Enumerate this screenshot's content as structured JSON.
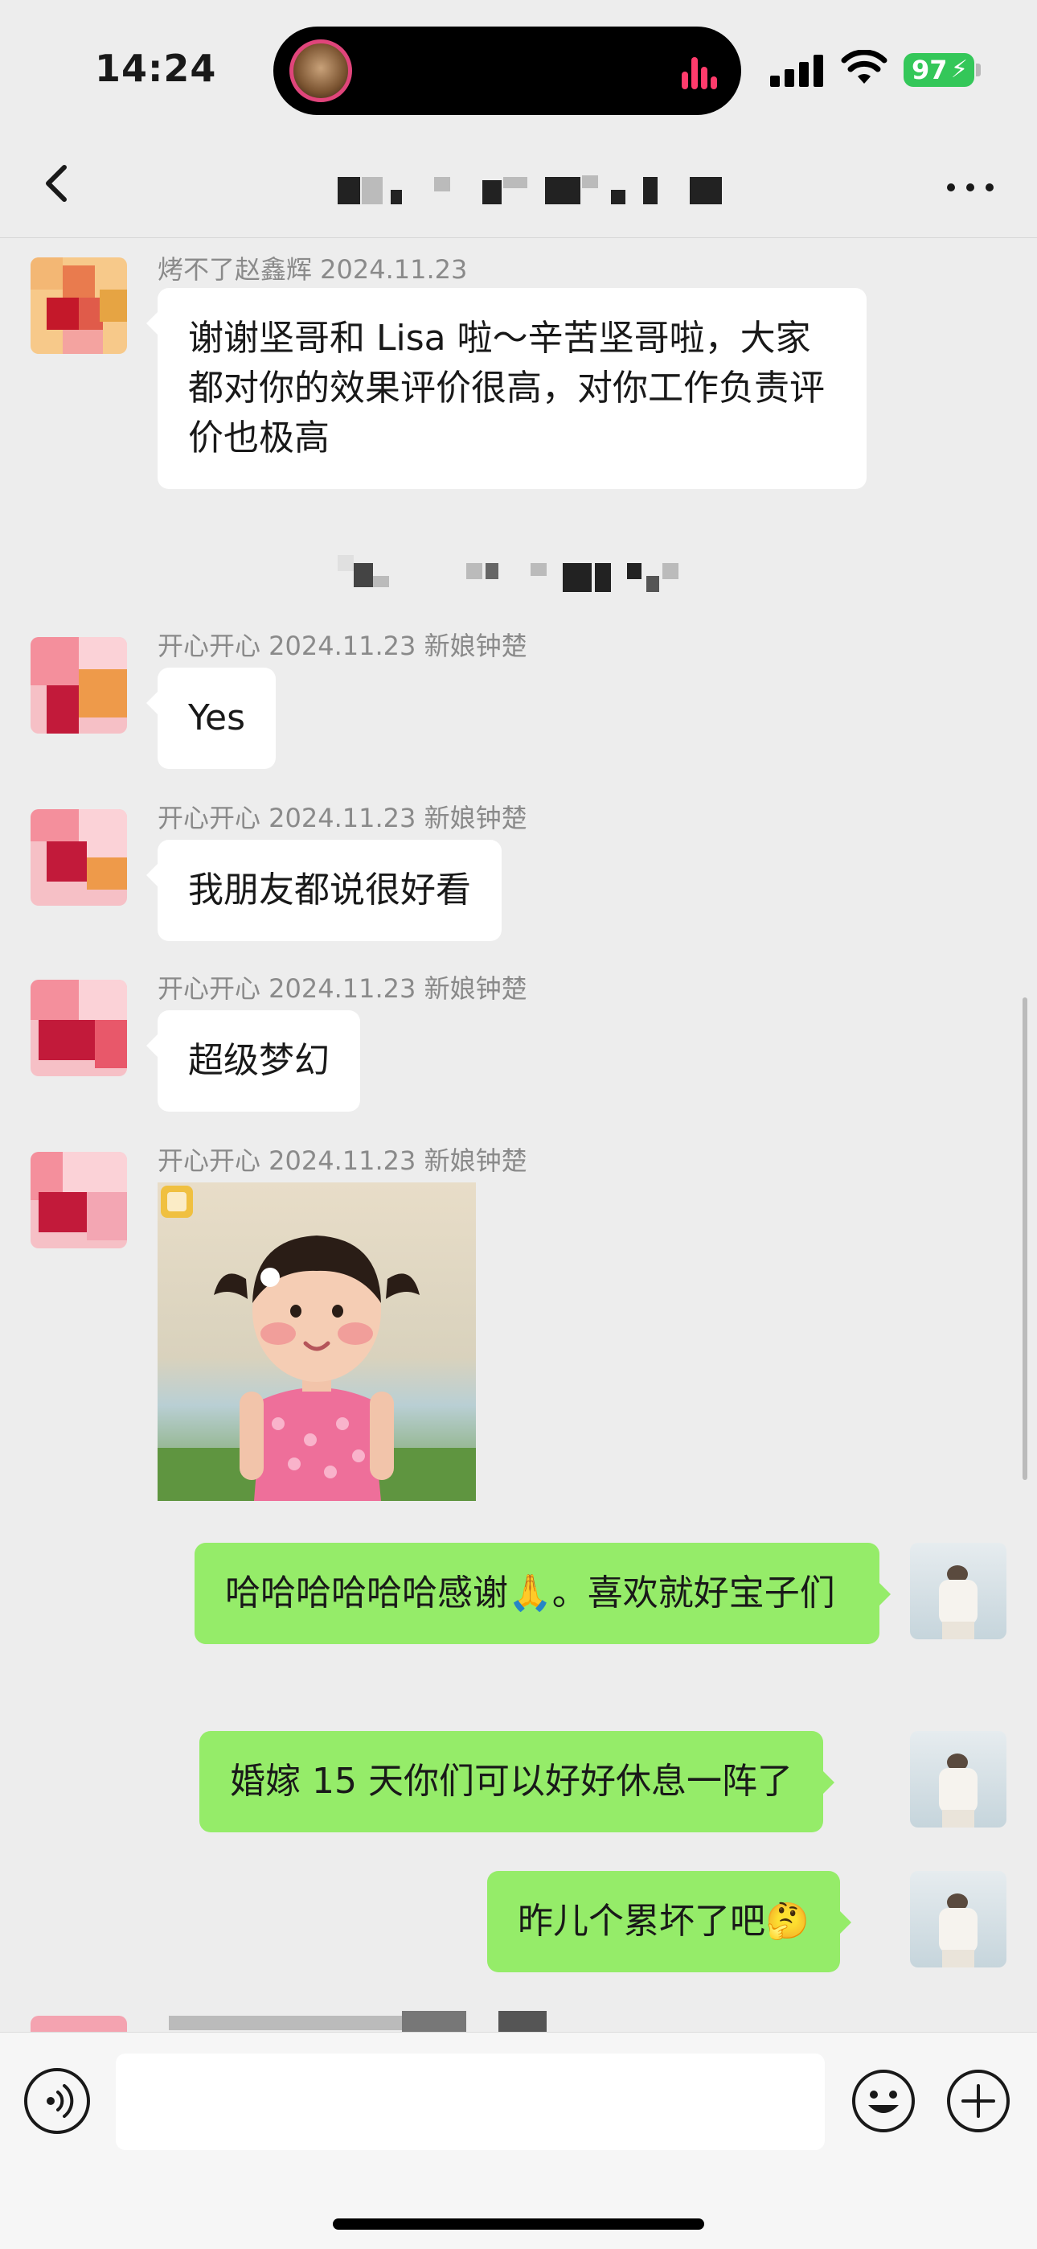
{
  "status_bar": {
    "time": "14:24",
    "battery": "97",
    "battery_color": "#34c759"
  },
  "header": {
    "title": "",
    "back_icon": "chevron-left-icon",
    "more_icon": "ellipsis-icon"
  },
  "messages": [
    {
      "side": "left",
      "sender": "烤不了赵鑫辉 2024.11.23",
      "text": "谢谢坚哥和 Lisa 啦～辛苦坚哥啦，大家都对你的效果评价很高，对你工作负责评价也极高"
    },
    {
      "side": "left",
      "sender": "开心开心 2024.11.23 新娘钟楚",
      "text": "Yes"
    },
    {
      "side": "left",
      "sender": "开心开心 2024.11.23 新娘钟楚",
      "text": "我朋友都说很好看"
    },
    {
      "side": "left",
      "sender": "开心开心 2024.11.23 新娘钟楚",
      "text": "超级梦幻"
    },
    {
      "side": "left",
      "sender": "开心开心 2024.11.23 新娘钟楚",
      "type": "sticker",
      "sticker": "little-girl-sticker"
    },
    {
      "side": "right",
      "text": "哈哈哈哈哈哈感谢🙏。喜欢就好宝子们"
    },
    {
      "side": "right",
      "text": "婚嫁 15 天你们可以好好休息一阵了"
    },
    {
      "side": "right",
      "text": "昨儿个累坏了吧🤔"
    }
  ],
  "input_bar": {
    "placeholder": "",
    "voice_icon": "voice-icon",
    "emoji_icon": "emoji-icon",
    "plus_icon": "plus-icon"
  },
  "colors": {
    "background": "#ededed",
    "incoming_bubble": "#ffffff",
    "outgoing_bubble": "#95ec69",
    "sender_text": "#8a8a8a"
  }
}
